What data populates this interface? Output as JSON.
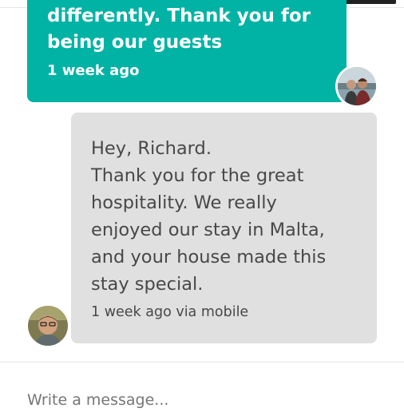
{
  "colors": {
    "host_bubble": "#00b3a4",
    "guest_bubble": "#e0e0e0",
    "guest_text": "#484848"
  },
  "messages": [
    {
      "sender": "host",
      "avatar_icon": "host-couple-avatar",
      "text_line1": "differently.  Thank you for",
      "text_line2": "being our guests",
      "meta": "1 week ago"
    },
    {
      "sender": "guest",
      "avatar_icon": "guest-avatar",
      "lines": [
        "Hey, Richard.",
        "Thank you for the great",
        "hospitality. We really",
        "enjoyed our stay in Malta,",
        "and your house made this",
        "stay special."
      ],
      "meta": "1 week ago via mobile"
    }
  ],
  "composer": {
    "placeholder": "Write a message..."
  }
}
